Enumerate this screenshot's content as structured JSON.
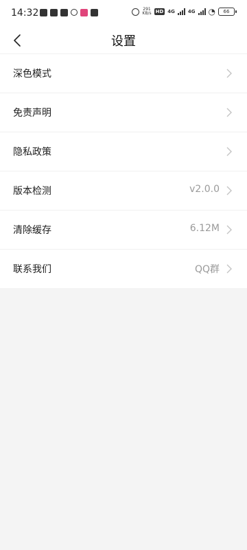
{
  "status_bar": {
    "time": "14:32",
    "net_speed": "291",
    "net_speed_unit": "KB/s",
    "network_a": "4G",
    "network_b": "4G",
    "battery": "66"
  },
  "header": {
    "title": "设置"
  },
  "menu": {
    "items": [
      {
        "label": "深色模式",
        "value": ""
      },
      {
        "label": "免责声明",
        "value": ""
      },
      {
        "label": "隐私政策",
        "value": ""
      },
      {
        "label": "版本检测",
        "value": "v2.0.0"
      },
      {
        "label": "清除缓存",
        "value": "6.12M"
      },
      {
        "label": "联系我们",
        "value": "QQ群"
      }
    ]
  },
  "colors": {
    "background": "#f4f4f4",
    "surface": "#ffffff",
    "text": "#1f1f1f",
    "secondary_text": "#9a9a9a"
  }
}
